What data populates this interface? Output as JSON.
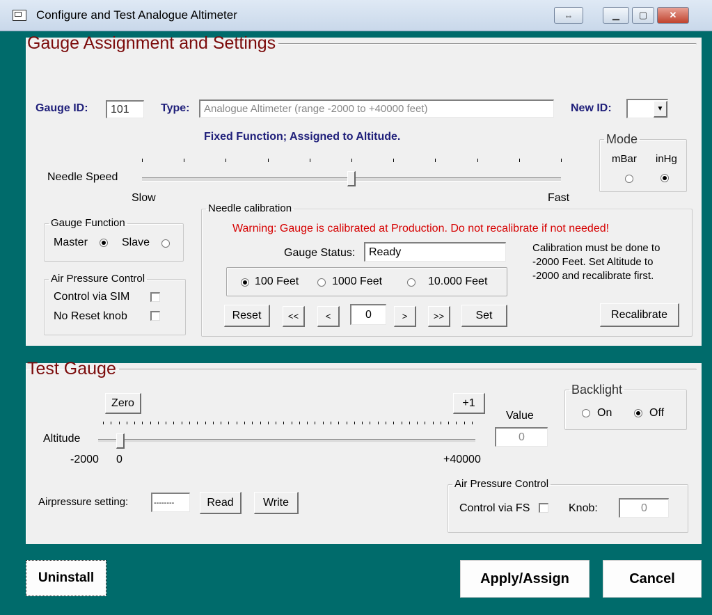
{
  "window": {
    "title": "Configure and Test Analogue Altimeter",
    "restore_glyph": "⇔",
    "min_glyph": "▁",
    "max_glyph": "▢",
    "close_glyph": "✕"
  },
  "settings": {
    "title": "Gauge Assignment and Settings",
    "gauge_id_label": "Gauge ID:",
    "gauge_id": "101",
    "type_label": "Type:",
    "type_value": "Analogue Altimeter (range -2000  to +40000 feet)",
    "new_id_label": "New ID:",
    "new_id_value": "",
    "fixed_function": "Fixed Function; Assigned to Altitude.",
    "needle_speed_label": "Needle Speed",
    "needle_speed_value": 0.5,
    "slow_label": "Slow",
    "fast_label": "Fast",
    "mode": {
      "label": "Mode",
      "mbar": "mBar",
      "inhg": "inHg",
      "selected": "inHg"
    },
    "gauge_function": {
      "label": "Gauge Function",
      "master": "Master",
      "slave": "Slave",
      "selected": "Master"
    },
    "air_pressure": {
      "label": "Air Pressure Control",
      "control_via_sim": "Control via SIM",
      "no_reset_knob": "No Reset knob"
    },
    "calibration": {
      "label": "Needle calibration",
      "warning": "Warning: Gauge is calibrated at Production. Do not recalibrate if not needed!",
      "status_label": "Gauge Status:",
      "status_value": "Ready",
      "note": [
        "Calibration must be done to",
        "-2000 Feet. Set Altitude to",
        "-2000 and recalibrate first."
      ],
      "steps": {
        "s100": "100 Feet",
        "s1000": "1000 Feet",
        "s10000": "10.000 Feet",
        "selected": "100 Feet"
      },
      "reset": "Reset",
      "bigback": "<<",
      "back": "<",
      "value": "0",
      "fwd": ">",
      "bigfwd": ">>",
      "set": "Set",
      "recalibrate": "Recalibrate"
    }
  },
  "test": {
    "title": "Test Gauge",
    "zero": "Zero",
    "plus_one": "+1",
    "value_label": "Value",
    "value": "0",
    "altitude_label": "Altitude",
    "min_label": "-2000",
    "zero_label": "0",
    "max_label": "+40000",
    "altitude_value": 0,
    "backlight": {
      "label": "Backlight",
      "on": "On",
      "off": "Off",
      "selected": "Off"
    },
    "airpressure_label": "Airpressure setting:",
    "airpressure_value": "--------",
    "read": "Read",
    "write": "Write",
    "air_pressure": {
      "label": "Air Pressure Control",
      "control_via_fs": "Control via FS",
      "knob_label": "Knob:",
      "knob_value": "0"
    }
  },
  "footer": {
    "uninstall": "Uninstall",
    "apply": "Apply/Assign",
    "cancel": "Cancel"
  }
}
